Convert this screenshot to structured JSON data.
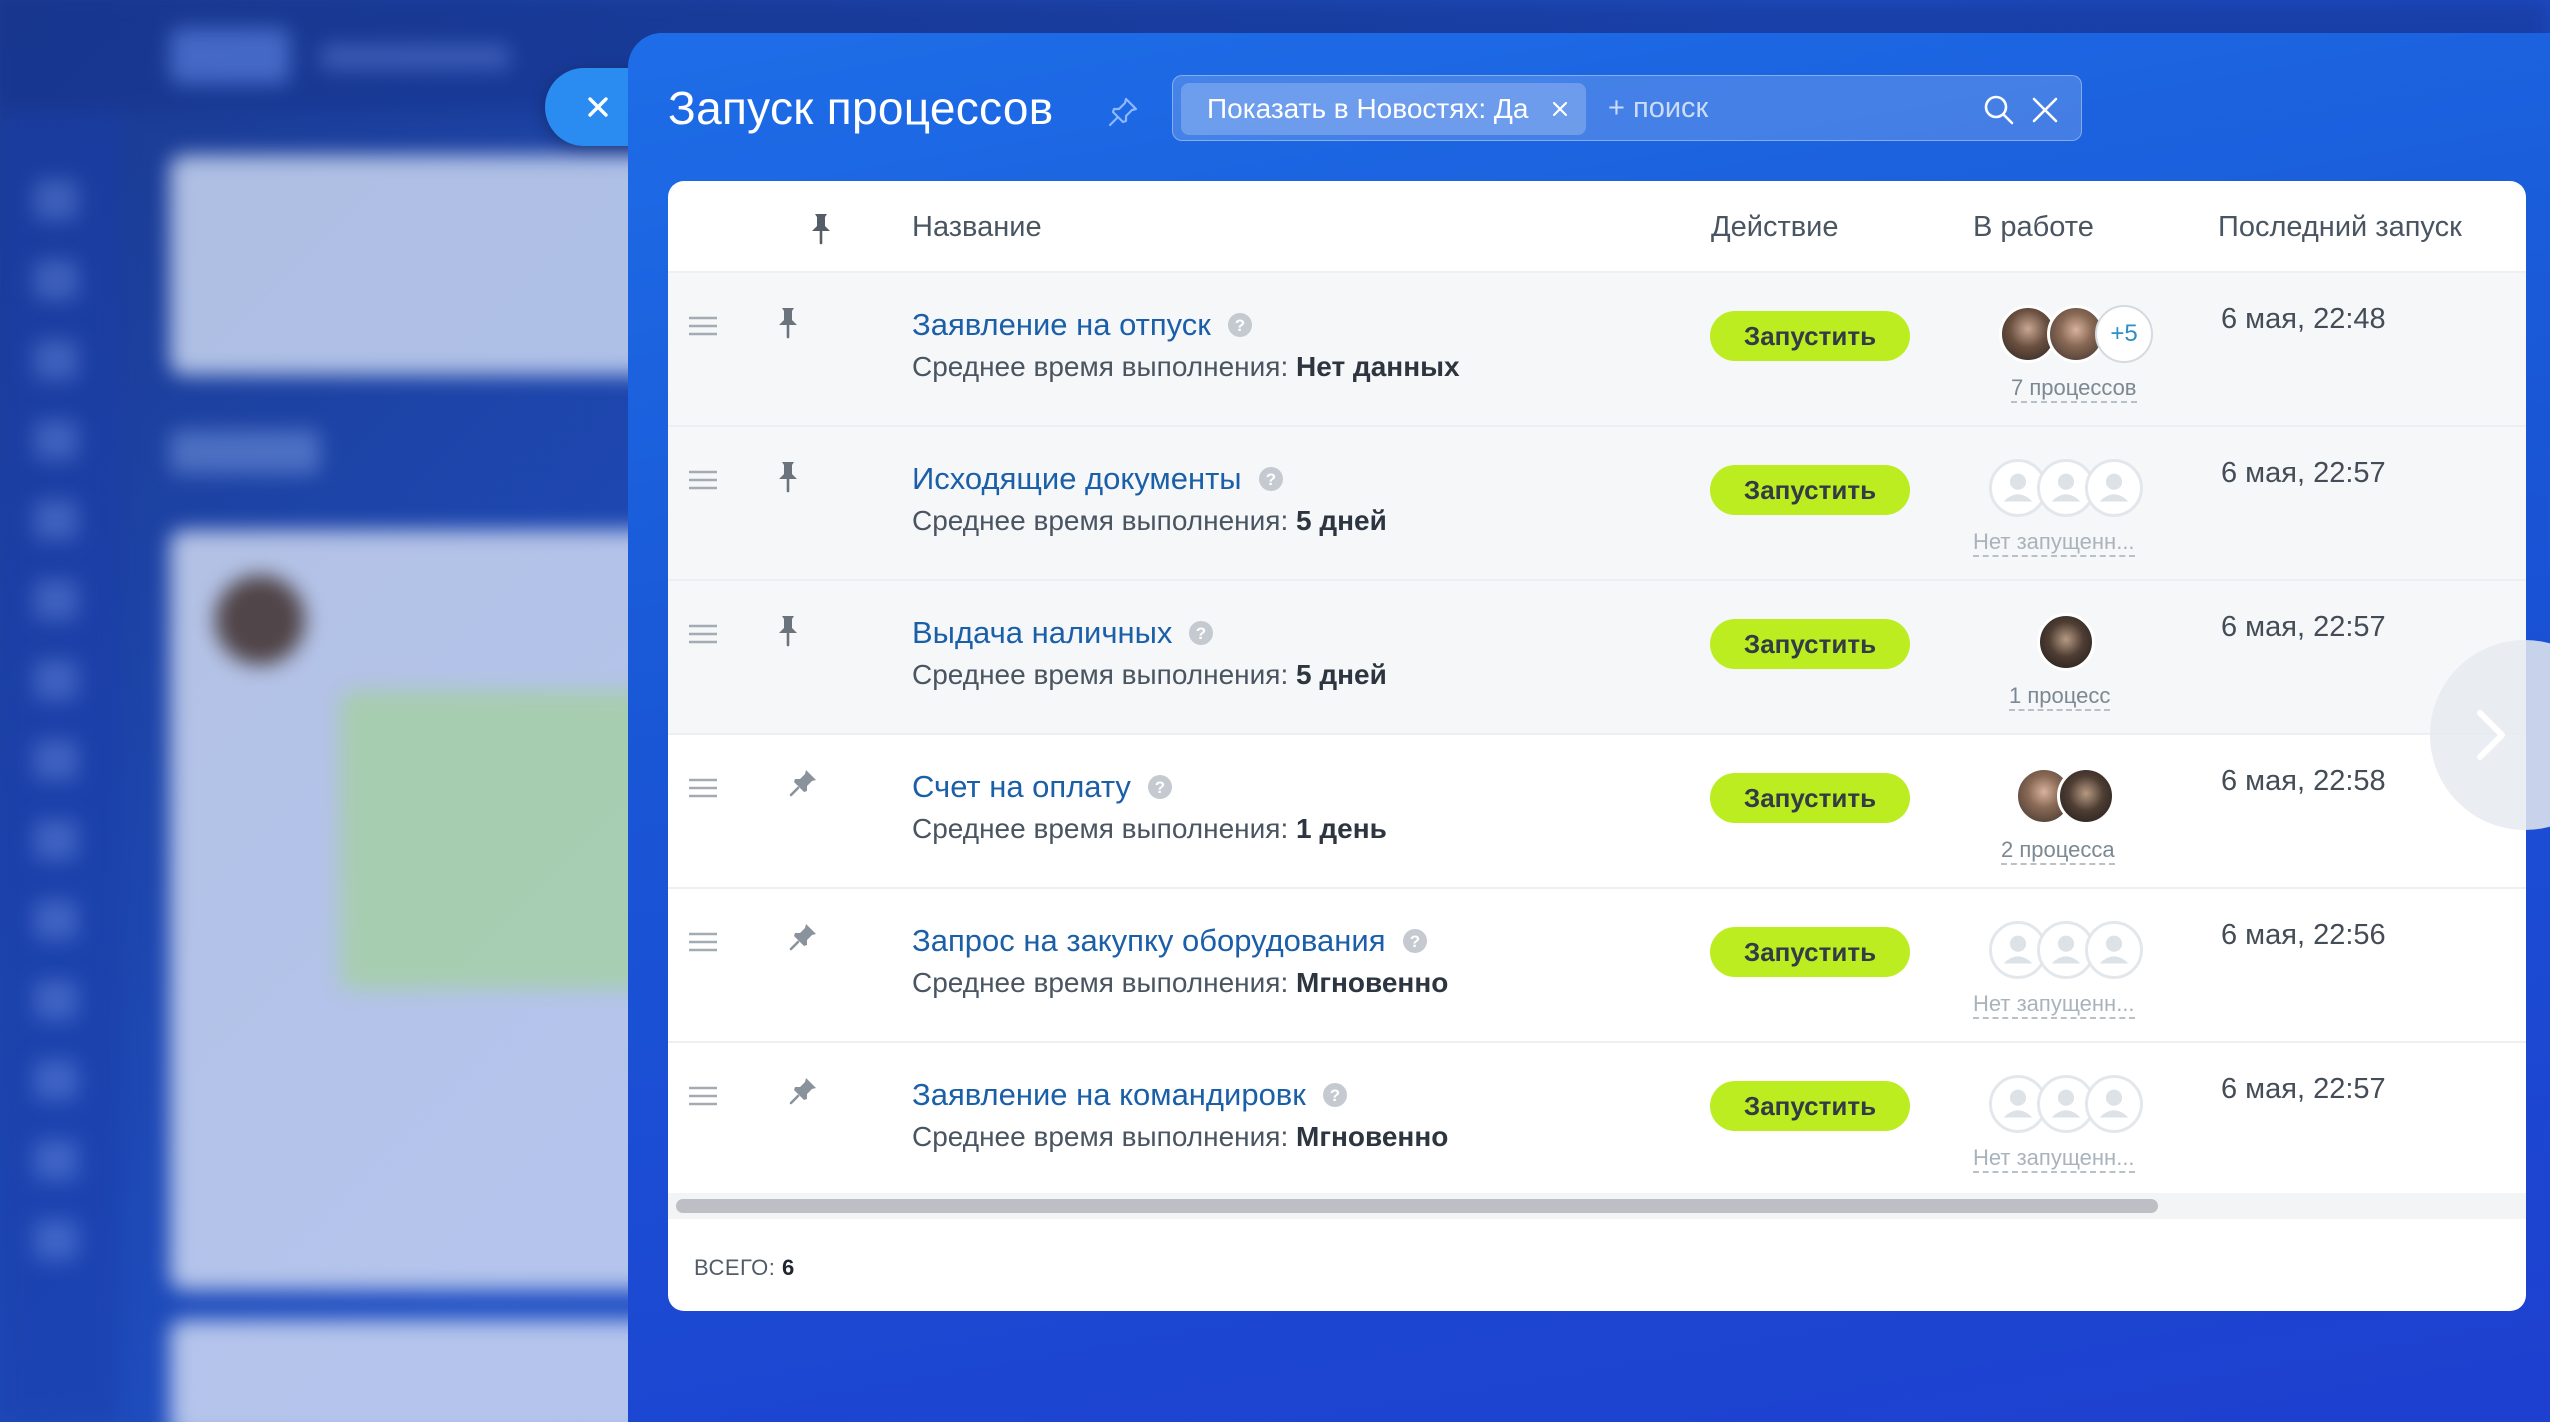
{
  "panel": {
    "title": "Запуск процессов",
    "filter": {
      "chip_label": "Показать в Новостях: Да",
      "search_placeholder": "+ поиск"
    }
  },
  "table": {
    "headers": {
      "name": "Название",
      "action": "Действие",
      "in_work": "В работе",
      "last_run": "Последний запуск"
    },
    "avg_time_label": "Среднее время выполнения:",
    "run_label": "Запустить",
    "rows": [
      {
        "name": "Заявление на отпуск",
        "avg_time": "Нет данных",
        "pinned": true,
        "processes": "7 процессов",
        "more": "+5",
        "last_run": "6 мая, 22:48"
      },
      {
        "name": "Исходящие документы",
        "avg_time": "5 дней",
        "pinned": true,
        "processes": "Нет запущенн...",
        "last_run": "6 мая, 22:57"
      },
      {
        "name": "Выдача наличных",
        "avg_time": "5 дней",
        "pinned": true,
        "processes": "1 процесс",
        "last_run": "6 мая, 22:57"
      },
      {
        "name": "Счет на оплату",
        "avg_time": "1 день",
        "pinned": false,
        "processes": "2 процесса",
        "last_run": "6 мая, 22:58"
      },
      {
        "name": "Запрос на закупку оборудования",
        "avg_time": "Мгновенно",
        "pinned": false,
        "processes": "Нет запущенн...",
        "last_run": "6 мая, 22:56"
      },
      {
        "name": "Заявление на командировк",
        "avg_time": "Мгновенно",
        "pinned": false,
        "processes": "Нет запущенн...",
        "last_run": "6 мая, 22:57"
      }
    ]
  },
  "footer": {
    "total_label": "ВСЕГО:",
    "total_value": "6"
  }
}
